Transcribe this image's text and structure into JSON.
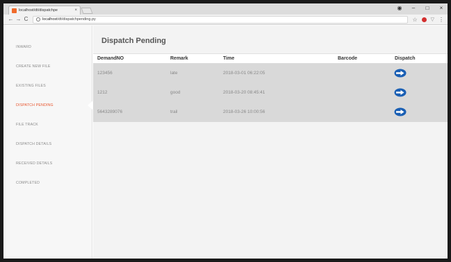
{
  "browser": {
    "tab_title": "localhost/dt/dispatchpe",
    "tab_close": "×",
    "window_controls": [
      "◉",
      "–",
      "□",
      "×"
    ],
    "nav": {
      "back": "←",
      "forward": "→",
      "reload": "C"
    },
    "url_host": "localhost",
    "url_path": "/dt/dispatchpending.py",
    "icons": {
      "star": "☆",
      "shield": "▽",
      "menu": "⋮"
    }
  },
  "sidebar": {
    "items": [
      {
        "label": "INWARD",
        "active": false
      },
      {
        "label": "CREATE NEW FILE",
        "active": false
      },
      {
        "label": "EXISTING FILES",
        "active": false
      },
      {
        "label": "DISPATCH PENDING",
        "active": true
      },
      {
        "label": "FILE TRACK",
        "active": false
      },
      {
        "label": "DISPATCH DETAILS",
        "active": false
      },
      {
        "label": "RECEIVED DETAILS",
        "active": false
      },
      {
        "label": "COMPLETED",
        "active": false
      }
    ]
  },
  "main": {
    "title": "Dispatch Pending",
    "table": {
      "headers": {
        "demand": "DemandNO",
        "remark": "Remark",
        "time": "Time",
        "barcode": "Barcode",
        "dispatch": "Dispatch"
      },
      "rows": [
        {
          "demand": "123456",
          "remark": "late",
          "time": "2018-03-01 06:22:05",
          "barcode": ""
        },
        {
          "demand": "1212",
          "remark": "good",
          "time": "2018-03-20 08:45:41",
          "barcode": ""
        },
        {
          "demand": "5643289076",
          "remark": "trail",
          "time": "2018-03-26 10:00:56",
          "barcode": ""
        }
      ]
    }
  },
  "colors": {
    "active": "#e8542c",
    "row_bg": "#d9d9d9",
    "dispatch_icon": "#1a5fb4"
  }
}
